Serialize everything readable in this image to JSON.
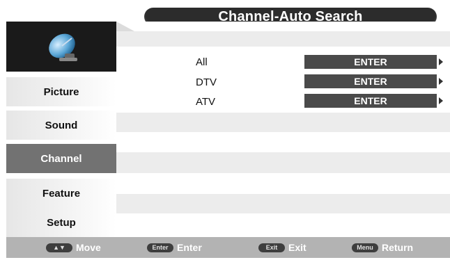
{
  "header": {
    "title": "Channel-Auto Search"
  },
  "sidebar": {
    "icon": "satellite-dish-icon",
    "items": [
      {
        "label": "Picture"
      },
      {
        "label": "Sound"
      },
      {
        "label": "Channel",
        "active": true
      },
      {
        "label": "Feature"
      },
      {
        "label": "Setup"
      }
    ]
  },
  "main": {
    "options": [
      {
        "label": "All",
        "button": "ENTER"
      },
      {
        "label": "DTV",
        "button": "ENTER"
      },
      {
        "label": "ATV",
        "button": "ENTER"
      }
    ]
  },
  "footer": {
    "hints": [
      {
        "key": "▲▼",
        "label": "Move"
      },
      {
        "key": "Enter",
        "label": "Enter"
      },
      {
        "key": "Exit",
        "label": "Exit"
      },
      {
        "key": "Menu",
        "label": "Return"
      }
    ]
  },
  "colors": {
    "accent": "#727272",
    "title_bg": "#2c2c2c",
    "button_bg": "#4a4a4a",
    "bar_bg": "#b3b3b3"
  }
}
